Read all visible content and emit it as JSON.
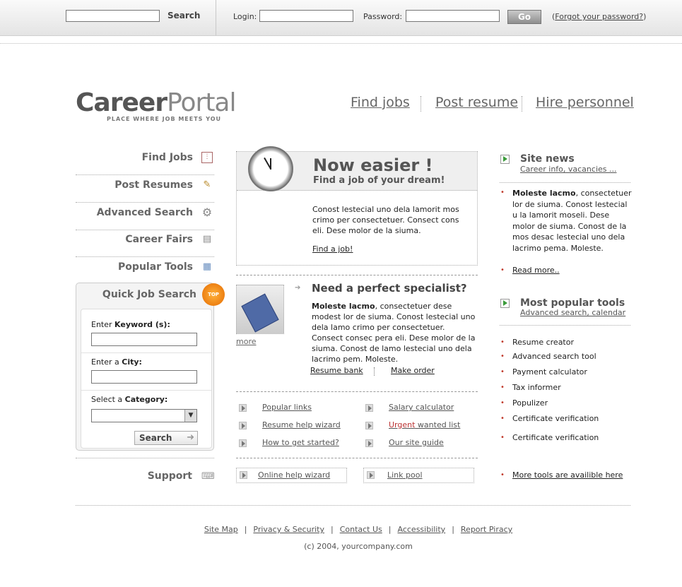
{
  "topbar": {
    "search_button": "Search",
    "login_label": "Login:",
    "password_label": "Password:",
    "go_button": "Go",
    "forgot_prefix": "(",
    "forgot_link": "Forgot your password?",
    "forgot_suffix": ")"
  },
  "logo": {
    "career": "Career",
    "portal": "Portal",
    "tagline": "PLACE WHERE JOB MEETS YOU"
  },
  "main_nav": [
    "Find jobs",
    "Post resume",
    "Hire personnel"
  ],
  "left_nav": [
    "Find Jobs",
    "Post Resumes",
    "Advanced Search",
    "Career Fairs",
    "Popular Tools"
  ],
  "quick_search": {
    "title": "Quick Job Search",
    "badge": "TOP",
    "keyword_prefix": "Enter ",
    "keyword_bold": "Keyword (s):",
    "city_prefix": "Enter a ",
    "city_bold": "City:",
    "category_prefix": "Select a ",
    "category_bold": "Category:",
    "search_button": "Search"
  },
  "support": "Support",
  "hero": {
    "title": "Now easier !",
    "subtitle": "Find a job of your dream!",
    "body": "Conost lestecial uno dela lamorit mos crimo per consectetuer. Consect cons eli. Dese molor de la siuma.",
    "link": "Find a job!"
  },
  "specialist": {
    "more": "more",
    "title": "Need a perfect specialist?",
    "body_bold": "Moleste lacmo",
    "body": ", consectetuer dese modest lor de siuma. Conost lestecial uno dela lamo crimo per consectetuer. Consect consec pera eli. Dese molor de la siuma. Conost de lamo lestecial uno dela lacrimo pem. Moleste.",
    "link1": "Resume bank",
    "link2": "Make order"
  },
  "quick_links": {
    "col1": [
      "Popular links",
      "Resume help wizard",
      "How to get started?"
    ],
    "col2_1": "Salary calculator",
    "col2_2_red": "Urgent",
    "col2_2_rest": " wanted list",
    "col2_3": "Our site guide",
    "footer1": "Online help wizard",
    "footer2": "Link pool"
  },
  "site_news": {
    "title": "Site news",
    "subtitle": "Career info, vacancies ...",
    "body_bold": "Moleste lacmo",
    "body": ", consectetuer lor de siuma. Conost lestecial u la lamorit moseli. Dese molor de siuma. Conost de la mos desac lestecial uno dela lacrimo pema. Moleste.",
    "read_more": "Read more.."
  },
  "popular_tools": {
    "title": "Most popular tools",
    "subtitle": "Advanced search, calendar",
    "items": [
      "Resume creator",
      "Advanced search tool",
      "Payment calculator",
      "Tax informer",
      "Populizer",
      "Certificate verification",
      "Certificate verification"
    ],
    "more": "More tools are availible here"
  },
  "footer": {
    "links": [
      "Site Map",
      "Privacy & Security",
      "Contact Us",
      "Accessibility",
      "Report Piracy"
    ],
    "separator": "|",
    "copyright": "(c) 2004, yourcompany.com"
  },
  "colors": {
    "accent_red": "#c0392b",
    "badge_orange": "#f08a1c",
    "arrow_green": "#3a9b3a"
  }
}
